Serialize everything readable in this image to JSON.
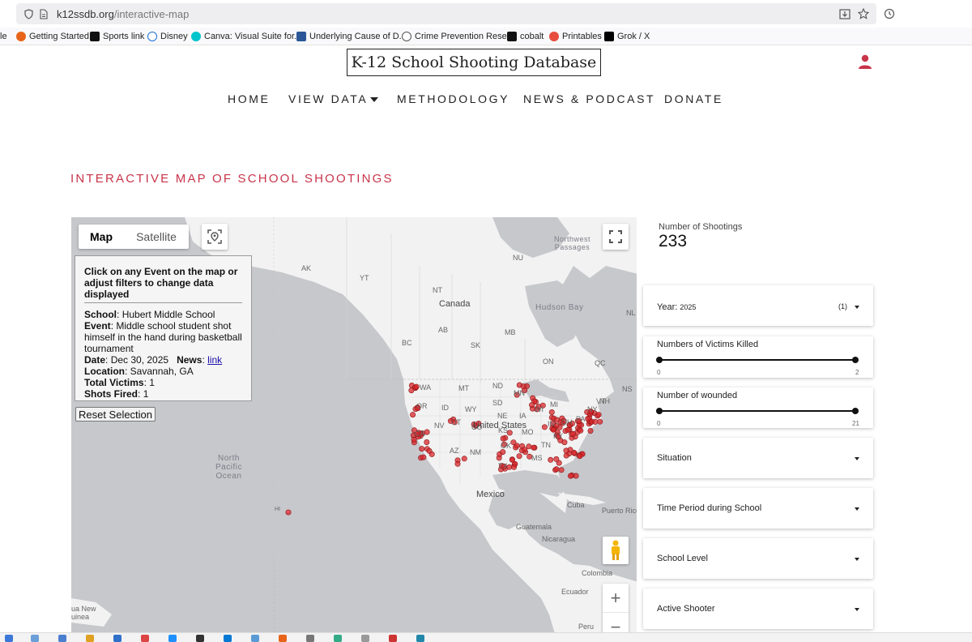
{
  "browser": {
    "url_domain": "k12ssdb.org",
    "url_path": "/interactive-map",
    "bookmarks": [
      {
        "label": "le",
        "color": ""
      },
      {
        "label": "Getting Started",
        "color": "#e8641b"
      },
      {
        "label": "Sports link",
        "color": "#111111"
      },
      {
        "label": "Disney",
        "color": "#1b6fd6"
      },
      {
        "label": "Canva: Visual Suite for...",
        "color": "#00c4cc"
      },
      {
        "label": "Underlying Cause of D...",
        "color": "#2b5797"
      },
      {
        "label": "Crime Prevention Rese...",
        "color": "#555555"
      },
      {
        "label": "cobalt",
        "color": "#111111"
      },
      {
        "label": "Printables",
        "color": "#e84c3d"
      },
      {
        "label": "Grok / X",
        "color": "#000000"
      }
    ]
  },
  "site": {
    "title": "K-12 School Shooting Database",
    "nav": {
      "home": "HOME",
      "view_data": "VIEW DATA",
      "methodology": "METHODOLOGY",
      "news": "NEWS & PODCAST",
      "donate": "DONATE"
    },
    "accent_color": "#c8344a"
  },
  "page": {
    "heading": "INTERACTIVE MAP OF SCHOOL SHOOTINGS"
  },
  "map": {
    "type_map": "Map",
    "type_satellite": "Satellite",
    "labels": {
      "canada": "Canada",
      "united_states": "United States",
      "mexico": "Mexico",
      "hudson_bay": "Hudson Bay",
      "north_pacific": "North\nPacific\nOcean",
      "cuba": "Cuba",
      "puerto_rico": "Puerto Rico",
      "guatemala": "Guatemala",
      "nicaragua": "Nicaragua",
      "colombia": "Colombia",
      "ecuador": "Ecuador",
      "peru": "Peru",
      "papua": "ua New\nuinea",
      "northwest_passages": "Northwest\nPassages",
      "hi": "HI"
    },
    "province_labels": [
      "AK",
      "YT",
      "NT",
      "NU",
      "BC",
      "AB",
      "SK",
      "MB",
      "ON",
      "QC",
      "NL",
      "WA",
      "MT",
      "ND",
      "MN",
      "OR",
      "ID",
      "WY",
      "SD",
      "NV",
      "NE",
      "IA",
      "UT",
      "CO",
      "KS",
      "MO",
      "CA",
      "AZ",
      "NM",
      "OK",
      "TX",
      "MS",
      "MI",
      "WI",
      "NY",
      "VT",
      "NH",
      "NS",
      "PA",
      "IN",
      "OH",
      "KY",
      "TN"
    ],
    "marker_color": "#d9262b",
    "info": {
      "header": "Click on any Event on the map or adjust filters to change data displayed",
      "school_label": "School",
      "school": "Hubert Middle School",
      "event_label": "Event",
      "event": "Middle school student shot himself in the hand during basketball tournament",
      "date_label": "Date",
      "date": "Dec 30, 2025",
      "news_label": "News",
      "news_link": "link",
      "location_label": "Location",
      "location": "Savannah, GA",
      "victims_label": "Total Victims",
      "victims": "1",
      "shots_label": "Shots Fired",
      "shots": "1"
    },
    "reset_button": "Reset Selection",
    "zoom_in": "+",
    "zoom_out": "−"
  },
  "filters": {
    "count_label": "Number of Shootings",
    "count_value": "233",
    "year": {
      "label": "Year:",
      "value": "2025",
      "count": "(1)"
    },
    "killed": {
      "label": "Numbers of Victims Killed",
      "min": "0",
      "max": "2",
      "low_fraction": 0,
      "high_fraction": 1
    },
    "wounded": {
      "label": "Number of wounded",
      "min": "0",
      "max": "21",
      "low_fraction": 0,
      "high_fraction": 1
    },
    "situation": "Situation",
    "time_period": "Time Period during School",
    "school_level": "School Level",
    "active_shooter": "Active Shooter"
  }
}
